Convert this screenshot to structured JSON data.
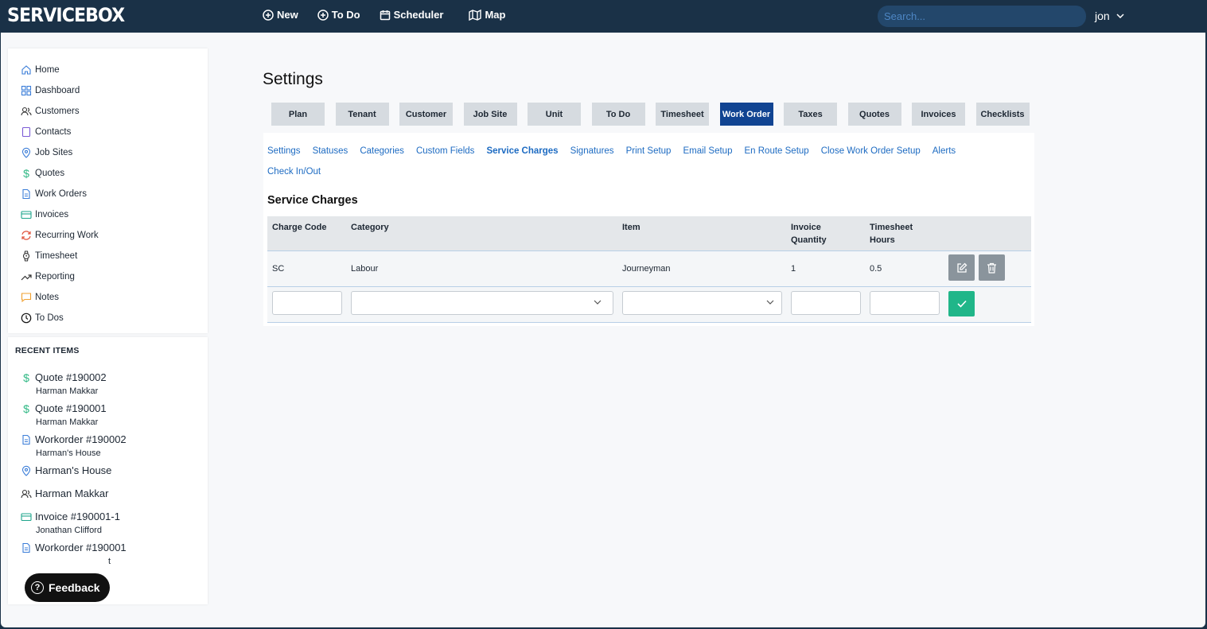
{
  "app": {
    "logo": "SERVICEBOX"
  },
  "topnav": [
    {
      "label": "New",
      "icon": "plus-circle-icon"
    },
    {
      "label": "To Do",
      "icon": "plus-circle-icon"
    },
    {
      "label": "Scheduler",
      "icon": "calendar-icon"
    },
    {
      "label": "Map",
      "icon": "map-icon"
    }
  ],
  "search": {
    "placeholder": "Search..."
  },
  "user": {
    "name": "jon"
  },
  "sidebar": {
    "items": [
      {
        "label": "Home",
        "icon": "home-icon"
      },
      {
        "label": "Dashboard",
        "icon": "grid-icon"
      },
      {
        "label": "Customers",
        "icon": "users-icon"
      },
      {
        "label": "Contacts",
        "icon": "book-icon"
      },
      {
        "label": "Job Sites",
        "icon": "map-pin-icon"
      },
      {
        "label": "Quotes",
        "icon": "dollar-icon"
      },
      {
        "label": "Work Orders",
        "icon": "document-icon"
      },
      {
        "label": "Invoices",
        "icon": "credit-card-icon"
      },
      {
        "label": "Recurring Work",
        "icon": "refresh-icon"
      },
      {
        "label": "Timesheet",
        "icon": "watch-icon"
      },
      {
        "label": "Reporting",
        "icon": "trending-up-icon"
      },
      {
        "label": "Notes",
        "icon": "message-icon"
      },
      {
        "label": "To Dos",
        "icon": "clock-icon"
      }
    ]
  },
  "recent": {
    "title": "RECENT ITEMS",
    "items": [
      {
        "label": "Quote #190002",
        "sub": "Harman Makkar",
        "icon": "dollar-icon"
      },
      {
        "label": "Quote #190001",
        "sub": "Harman Makkar",
        "icon": "dollar-icon"
      },
      {
        "label": "Workorder #190002",
        "sub": "Harman's House",
        "icon": "document-icon"
      },
      {
        "label": "Harman's House",
        "sub": "",
        "icon": "map-pin-icon"
      },
      {
        "label": "Harman Makkar",
        "sub": "",
        "icon": "users-icon"
      },
      {
        "label": "Invoice #190001-1",
        "sub": "Jonathan Clifford",
        "icon": "credit-card-icon"
      },
      {
        "label": "Workorder #190001",
        "sub": "t",
        "icon": "document-icon"
      }
    ]
  },
  "feedback": {
    "label": "Feedback"
  },
  "page": {
    "title": "Settings"
  },
  "tabs": [
    "Plan",
    "Tenant",
    "Customer",
    "Job Site",
    "Unit",
    "To Do",
    "Timesheet",
    "Work Order",
    "Taxes",
    "Quotes",
    "Invoices",
    "Checklists"
  ],
  "active_tab": "Work Order",
  "subtabs": [
    "Settings",
    "Statuses",
    "Categories",
    "Custom Fields",
    "Service Charges",
    "Signatures",
    "Print Setup",
    "Email Setup",
    "En Route Setup",
    "Close Work Order Setup",
    "Alerts",
    "Check In/Out"
  ],
  "active_subtab": "Service Charges",
  "section": {
    "title": "Service Charges"
  },
  "table": {
    "headers": [
      "Charge Code",
      "Category",
      "Item",
      "Invoice Quantity",
      "Timesheet Hours"
    ],
    "rows": [
      {
        "charge_code": "SC",
        "category": "Labour",
        "item": "Journeyman",
        "invoice_quantity": "1",
        "timesheet_hours": "0.5"
      }
    ]
  },
  "colors": {
    "topbar": "#1a3147",
    "active_tab": "#114492",
    "link": "#1d6bc2",
    "confirm": "#20b689",
    "action": "#8a949c"
  }
}
